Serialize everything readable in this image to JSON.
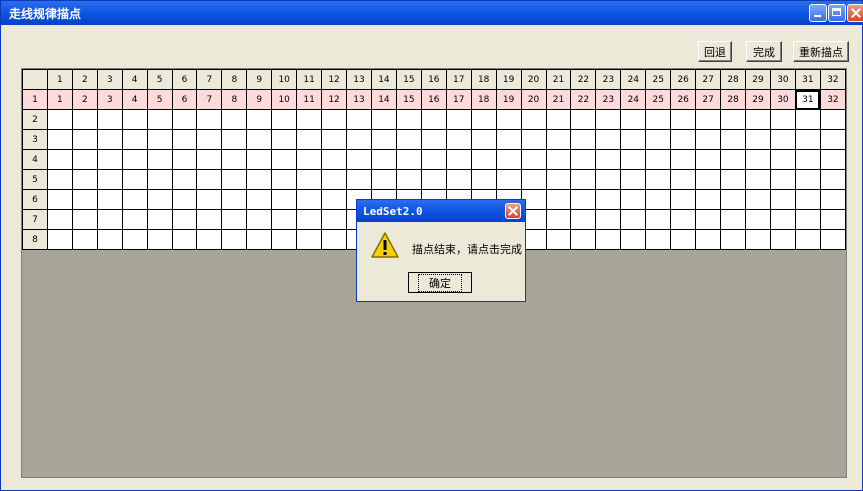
{
  "window": {
    "title": "走线规律描点"
  },
  "toolbar": {
    "back_label": "回退",
    "done_label": "完成",
    "redraw_label": "重新描点"
  },
  "grid": {
    "columns": [
      "1",
      "2",
      "3",
      "4",
      "5",
      "6",
      "7",
      "8",
      "9",
      "10",
      "11",
      "12",
      "13",
      "14",
      "15",
      "16",
      "17",
      "18",
      "19",
      "20",
      "21",
      "22",
      "23",
      "24",
      "25",
      "26",
      "27",
      "28",
      "29",
      "30",
      "31",
      "32"
    ],
    "rows": [
      "1",
      "2",
      "3",
      "4",
      "5",
      "6",
      "7",
      "8"
    ],
    "row1_values": [
      "1",
      "2",
      "3",
      "4",
      "5",
      "6",
      "7",
      "8",
      "9",
      "10",
      "11",
      "12",
      "13",
      "14",
      "15",
      "16",
      "17",
      "18",
      "19",
      "20",
      "21",
      "22",
      "23",
      "24",
      "25",
      "26",
      "27",
      "28",
      "29",
      "30",
      "31",
      "32"
    ],
    "highlight_color": "#ffdada",
    "selected_cell": "31"
  },
  "dialog": {
    "title": "LedSet2.0",
    "icon": "warning-icon",
    "message": "描点结束，请点击完成",
    "ok_label": "确定"
  }
}
